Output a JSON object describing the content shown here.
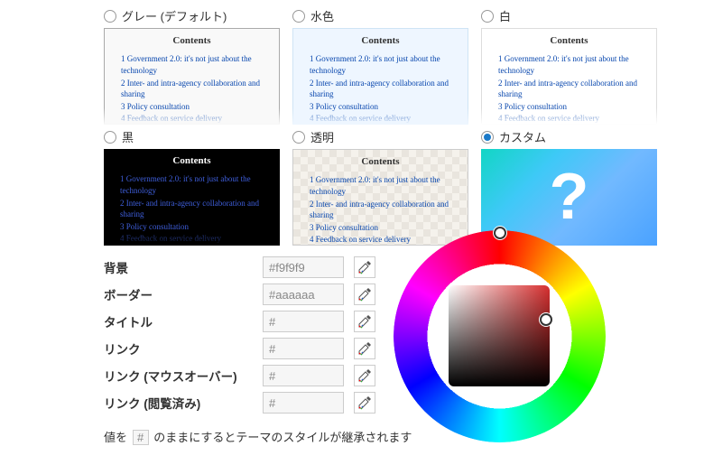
{
  "themes": [
    {
      "id": "gray",
      "label": "グレー (デフォルト)",
      "selected": false
    },
    {
      "id": "light",
      "label": "水色",
      "selected": false
    },
    {
      "id": "white",
      "label": "白",
      "selected": false
    },
    {
      "id": "black",
      "label": "黒",
      "selected": false
    },
    {
      "id": "transp",
      "label": "透明",
      "selected": false
    },
    {
      "id": "custom",
      "label": "カスタム",
      "selected": true
    }
  ],
  "preview": {
    "heading": "Contents",
    "items": [
      "1 Government 2.0: it's not just about the technology",
      "2 Inter- and intra-agency collaboration and sharing",
      "3 Policy consultation",
      "4 Feedback on service delivery"
    ]
  },
  "custom_glyph": "?",
  "fields": {
    "bg": {
      "label": "背景",
      "value": "#f9f9f9"
    },
    "border": {
      "label": "ボーダー",
      "value": "#aaaaaa"
    },
    "title": {
      "label": "タイトル",
      "value": "#"
    },
    "link": {
      "label": "リンク",
      "value": "#"
    },
    "link_hover": {
      "label": "リンク (マウスオーバー)",
      "value": "#"
    },
    "link_visit": {
      "label": "リンク (閲覧済み)",
      "value": "#"
    }
  },
  "note": {
    "pre": "値を",
    "hash": "#",
    "post": "のままにするとテーマのスタイルが継承されます"
  }
}
